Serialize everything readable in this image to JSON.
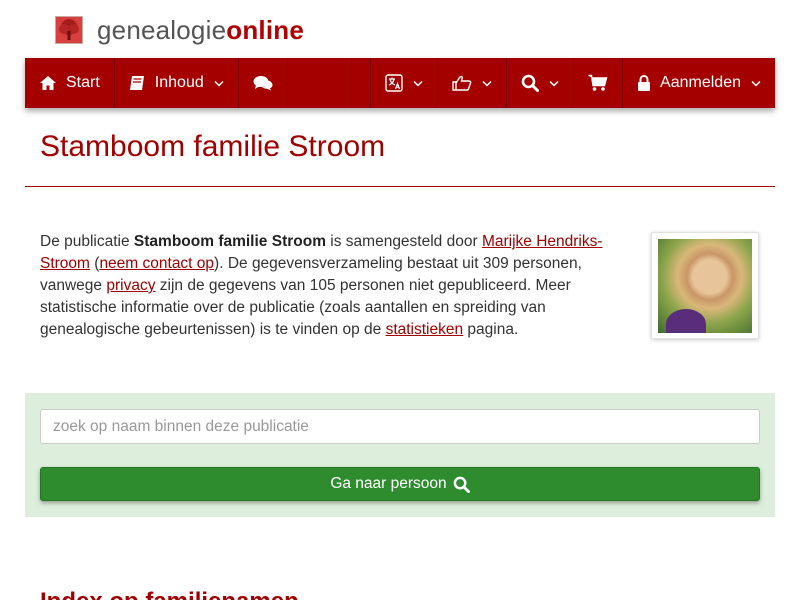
{
  "logo": {
    "text_plain": "genealogie",
    "text_highlight": "online",
    "icon": "tree-icon"
  },
  "navbar": {
    "start_label": "Start",
    "content_label": "Inhoud",
    "login_label": "Aanmelden",
    "icons": {
      "start": "home-icon",
      "content": "book-icon",
      "chat": "comments-icon",
      "language": "translate-icon",
      "share": "thumbs-up-icon",
      "search": "search-icon",
      "cart": "shopping-cart-icon",
      "login": "lock-icon"
    }
  },
  "page": {
    "title": "Stamboom familie Stroom"
  },
  "intro": {
    "t1": "De publicatie ",
    "pub_name": "Stamboom familie Stroom",
    "t2": " is samengesteld door ",
    "author_link": "Marijke Hendriks-Stroom",
    "t3": " (",
    "contact_link": "neem contact op",
    "t4": "). De gegevensverzameling bestaat uit 309 personen, vanwege ",
    "privacy_link": "privacy",
    "t5": " zijn de gegevens van 105 personen niet gepubliceerd. Meer statistische informatie over de publicatie (zoals aantallen en spreiding van genealogische gebeurtenissen) is te vinden op de ",
    "stats_link": "statistieken",
    "t6": " pagina."
  },
  "search": {
    "placeholder": "zoek op naam binnen deze publicatie",
    "button_label": "Ga naar persoon"
  },
  "section": {
    "title": "Index op familienamen"
  },
  "colors": {
    "brand_red": "#a50000",
    "panel_green": "#ddefdc",
    "button_green": "#2e8b2e"
  }
}
